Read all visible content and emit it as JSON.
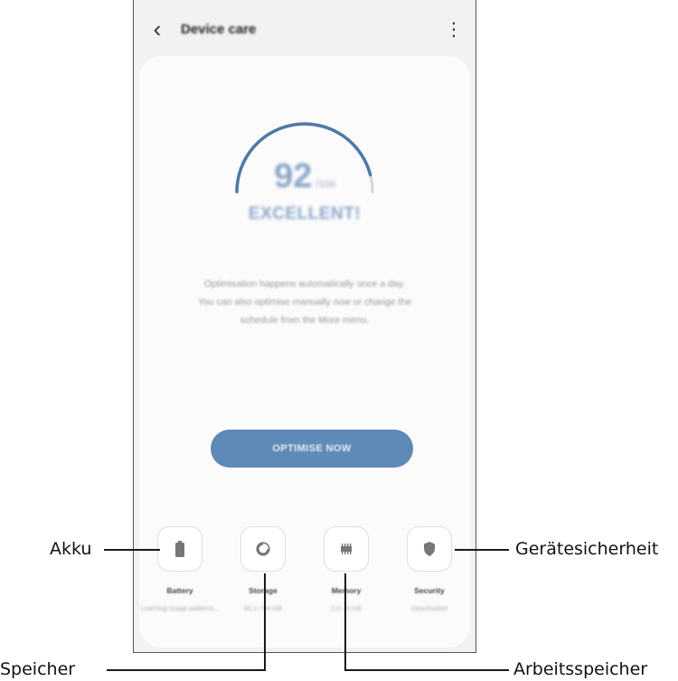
{
  "app": {
    "title": "Device care",
    "back_icon": "chevron-left-icon",
    "more_icon": "more-vertical-icon"
  },
  "score": {
    "value": "92",
    "max": "/100",
    "status": "EXCELLENT!",
    "fraction": 0.92
  },
  "description": [
    "Optimisation happens automatically once a day.",
    "You can also optimise manually now or change the",
    "schedule from the More menu."
  ],
  "optimise_button": "OPTIMISE NOW",
  "tiles": [
    {
      "label": "Battery",
      "sub": "Learning usage patterns...",
      "icon": "battery-icon"
    },
    {
      "label": "Storage",
      "sub": "60.1 / 64 GB",
      "icon": "storage-pie-icon"
    },
    {
      "label": "Memory",
      "sub": "2.0 / 6 GB",
      "icon": "memory-chip-icon"
    },
    {
      "label": "Security",
      "sub": "Deactivated",
      "icon": "shield-icon"
    }
  ],
  "callouts": {
    "akku": "Akku",
    "speicher": "Speicher",
    "arbeitsspeicher": "Arbeitsspeicher",
    "geraetesicherheit": "Gerätesicherheit"
  },
  "colors": {
    "accent": "#5f89b7",
    "gauge": "#4f78a8",
    "gauge_track": "#d7d9dc"
  }
}
